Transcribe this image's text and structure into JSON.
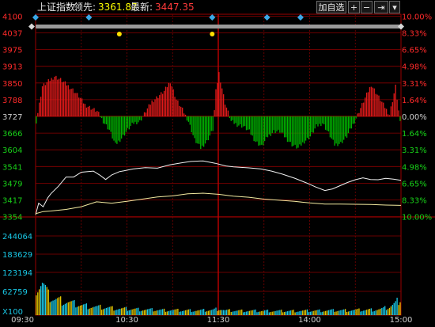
{
  "header": {
    "index_name": "上证指数",
    "lead_label": "领先:",
    "lead_value": "3361.87",
    "last_label": "最新:",
    "last_value": "3447.35",
    "controls": {
      "auto_label": "加自选",
      "zoom_in": "+",
      "zoom_out": "−",
      "next": "⇥",
      "menu": "▾"
    }
  },
  "chart_data": {
    "type": "line",
    "title": "上证指数",
    "price_axis": {
      "ticks_top": [
        "4100",
        "4037",
        "3975",
        "3913",
        "3850",
        "3788"
      ],
      "base": "3727",
      "ticks_bottom": [
        "3666",
        "3604",
        "3541",
        "3479",
        "3417",
        "3354"
      ],
      "ylim": [
        3354,
        4100
      ]
    },
    "pct_axis": {
      "ticks_top": [
        "10.00%",
        "8.33%",
        "6.65%",
        "4.98%",
        "3.31%",
        "1.64%"
      ],
      "base": "0.00%",
      "ticks_bottom": [
        "1.64%",
        "3.31%",
        "4.98%",
        "6.65%",
        "8.33%",
        "10.00%"
      ]
    },
    "volume_axis": {
      "ticks": [
        "244064",
        "183629",
        "123194",
        "62759"
      ],
      "unit": "X100",
      "ylim": [
        0,
        244064
      ]
    },
    "time_axis": {
      "ticks": [
        "09:30",
        "10:30",
        "11:30",
        "14:00",
        "15:00"
      ]
    },
    "x_range": [
      0,
      240
    ],
    "series": [
      {
        "name": "最新",
        "color": "#f0f0f0",
        "x": [
          0,
          2,
          5,
          8,
          10,
          15,
          20,
          25,
          30,
          38,
          42,
          46,
          50,
          55,
          58,
          64,
          72,
          80,
          88,
          96,
          102,
          110,
          118,
          125,
          130,
          140,
          148,
          155,
          162,
          170,
          178,
          184,
          190,
          195,
          200,
          205,
          210,
          215,
          220,
          225,
          230,
          235,
          240
        ],
        "values": [
          3362,
          3405,
          3392,
          3425,
          3440,
          3468,
          3502,
          3502,
          3520,
          3524,
          3510,
          3493,
          3510,
          3522,
          3525,
          3532,
          3537,
          3535,
          3547,
          3555,
          3560,
          3562,
          3553,
          3543,
          3540,
          3536,
          3532,
          3524,
          3513,
          3498,
          3480,
          3465,
          3452,
          3458,
          3470,
          3482,
          3492,
          3499,
          3493,
          3492,
          3497,
          3494,
          3490
        ]
      },
      {
        "name": "领先",
        "color": "#f3eaa0",
        "x": [
          0,
          5,
          10,
          20,
          30,
          40,
          50,
          60,
          70,
          80,
          90,
          100,
          110,
          120,
          130,
          140,
          150,
          160,
          170,
          180,
          190,
          200,
          210,
          220,
          230,
          240
        ],
        "values": [
          3366,
          3374,
          3376,
          3382,
          3392,
          3410,
          3405,
          3412,
          3420,
          3428,
          3432,
          3440,
          3442,
          3438,
          3431,
          3427,
          3420,
          3416,
          3412,
          3406,
          3402,
          3402,
          3401,
          3400,
          3398,
          3397
        ]
      }
    ],
    "breadth": {
      "color_up": "#e01a1a",
      "color_down": "#00b300",
      "x": [
        0,
        4,
        8,
        12,
        16,
        20,
        24,
        28,
        32,
        36,
        40,
        44,
        48,
        52,
        56,
        60,
        64,
        68,
        72,
        76,
        80,
        84,
        88,
        92,
        96,
        100,
        104,
        108,
        112,
        116,
        118,
        120,
        124,
        128,
        132,
        136,
        140,
        144,
        148,
        152,
        156,
        160,
        164,
        168,
        172,
        176,
        180,
        184,
        188,
        192,
        196,
        200,
        204,
        208,
        212,
        216,
        220,
        224,
        228,
        232,
        236,
        239
      ],
      "values": [
        -0.3,
        1.8,
        2.1,
        2.4,
        2.2,
        1.9,
        1.6,
        1.2,
        0.7,
        0.5,
        0.3,
        -0.3,
        -0.8,
        -1.7,
        -1.3,
        -0.8,
        -0.4,
        -0.3,
        0.3,
        0.9,
        1.2,
        1.5,
        2.1,
        1.0,
        0.4,
        -0.3,
        -1.4,
        -1.9,
        -1.5,
        -0.8,
        1.5,
        2.6,
        0.8,
        -0.3,
        -0.5,
        -0.6,
        -0.9,
        -1.5,
        -1.8,
        -1.2,
        -0.9,
        -0.9,
        -1.3,
        -1.7,
        -1.9,
        -1.5,
        -1.2,
        -0.6,
        -0.4,
        -1.0,
        -1.7,
        -1.6,
        -1.2,
        -0.5,
        0.3,
        1.1,
        1.9,
        1.3,
        0.7,
        0.1,
        1.8,
        -0.4
      ]
    },
    "volume": {
      "color_up": "#e0c400",
      "color_down": "#19c8e6",
      "x": [
        0,
        4,
        8,
        12,
        16,
        20,
        24,
        28,
        32,
        36,
        40,
        44,
        48,
        52,
        56,
        60,
        64,
        68,
        72,
        76,
        80,
        84,
        88,
        92,
        96,
        100,
        104,
        108,
        112,
        116,
        120,
        124,
        128,
        132,
        136,
        140,
        144,
        148,
        152,
        156,
        160,
        164,
        168,
        172,
        176,
        180,
        184,
        188,
        192,
        196,
        200,
        204,
        208,
        212,
        216,
        220,
        224,
        228,
        232,
        236,
        239
      ],
      "values": [
        90000,
        98000,
        58000,
        48000,
        44000,
        40000,
        35000,
        31000,
        28000,
        26000,
        24000,
        23000,
        22000,
        20000,
        19000,
        18500,
        18000,
        17000,
        16500,
        16000,
        15500,
        15000,
        14800,
        14500,
        14000,
        14200,
        14000,
        13800,
        14600,
        15200,
        20000,
        13800,
        13500,
        13200,
        13000,
        12800,
        12700,
        12500,
        12800,
        12400,
        12300,
        12200,
        12500,
        12700,
        12800,
        13000,
        13200,
        13500,
        13800,
        14000,
        14200,
        14500,
        14800,
        15200,
        15500,
        16000,
        17000,
        19000,
        25000,
        35000,
        52000
      ]
    },
    "markers": {
      "yellow_dots_at": [
        55,
        116
      ],
      "diamonds_top_at": [
        0,
        35,
        116,
        152,
        174
      ],
      "diamonds_track_at": [
        0,
        240
      ]
    }
  }
}
